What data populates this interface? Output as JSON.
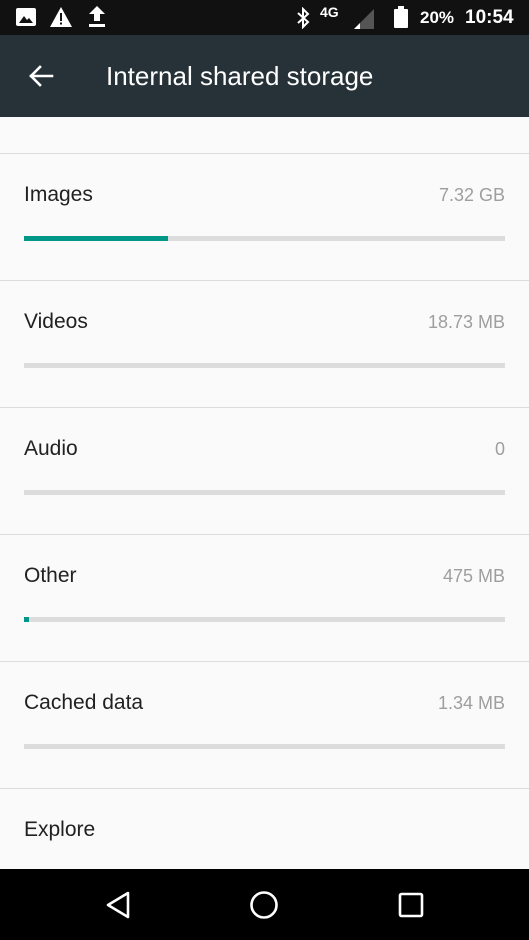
{
  "status_bar": {
    "battery_percent": "20%",
    "time": "10:54",
    "network": "4G",
    "icons": [
      "image-icon",
      "warning-icon",
      "upload-icon",
      "bluetooth-icon",
      "4g-lte-icon",
      "signal-icon",
      "battery-icon"
    ]
  },
  "app_bar": {
    "title": "Internal shared storage",
    "back_icon": "arrow-back-icon"
  },
  "categories": [
    {
      "label": "Images",
      "size": "7.32 GB",
      "usage_fraction": 0.3
    },
    {
      "label": "Videos",
      "size": "18.73 MB",
      "usage_fraction": 0.0
    },
    {
      "label": "Audio",
      "size": "0",
      "usage_fraction": 0.0
    },
    {
      "label": "Other",
      "size": "475 MB",
      "usage_fraction": 0.01
    },
    {
      "label": "Cached data",
      "size": "1.34 MB",
      "usage_fraction": 0.0
    }
  ],
  "explore": {
    "label": "Explore"
  },
  "colors": {
    "app_bar": "#263238",
    "accent": "#009688",
    "track": "#dcdcdc",
    "background": "#fafafa"
  },
  "nav_bar": {
    "icons": [
      "back-triangle-icon",
      "home-circle-icon",
      "recents-square-icon"
    ]
  }
}
